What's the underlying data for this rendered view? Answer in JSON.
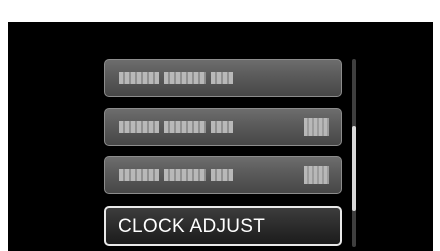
{
  "menu": {
    "items": [
      {
        "label": "",
        "has_value": false
      },
      {
        "label": "",
        "has_value": true
      },
      {
        "label": "",
        "has_value": true
      },
      {
        "label": "CLOCK ADJUST",
        "selected": true
      }
    ],
    "scroll_position": 0.65,
    "scroll_visible_fraction": 0.45
  }
}
